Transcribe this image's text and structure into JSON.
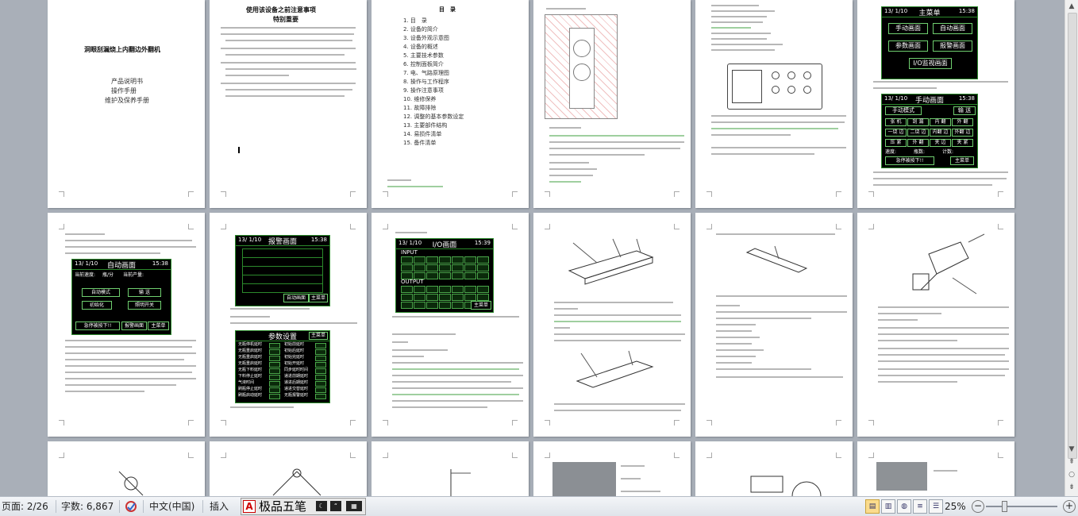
{
  "pages": {
    "p1": {
      "title": "洞眼刮漏烧上内翻边外翻机",
      "lines": [
        "产品说明书",
        "操作手册",
        "维护及保养手册"
      ]
    },
    "p2": {
      "title": "使用该设备之前注意事项",
      "subtitle": "特别重要"
    },
    "p3": {
      "title": "目　录",
      "items": [
        "1. 目　录",
        "2. 设备的简介",
        "3. 设备外观示意图",
        "4. 设备的概述",
        "5. 主要技术参数",
        "6. 控制面板简介",
        "7. 电、气路原理图",
        "8. 操作与工作程序",
        "9. 操作注意事项",
        "10. 维修保养",
        "11. 故障排除",
        "12. 调整的基本参数设定",
        "13. 主要部件结构",
        "14. 易损件清单",
        "15. 备件清单"
      ]
    },
    "p6": {
      "main_menu": {
        "date": "13/ 1/10",
        "time": "15:38",
        "title": "主菜单",
        "buttons": [
          "手动画面",
          "自动画面",
          "参数画面",
          "报警画面",
          "I/O监视画面"
        ]
      },
      "manual": {
        "date": "13/ 1/10",
        "time": "15:38",
        "title": "手动画面",
        "mode": "手动模式",
        "send": "输 送",
        "grid": [
          "张 机",
          "刮 漏",
          "内 翻",
          "外 翻",
          "一烧 边",
          "二烧 边",
          "内翻 边",
          "外翻 边",
          "压 紧",
          "外 翻",
          "夹 边",
          "夹 紧"
        ],
        "status": [
          "速度:",
          "瓶数:",
          "计数:"
        ],
        "estop": "急停被按下!!",
        "menu": "主菜单"
      }
    },
    "p7": {
      "auto": {
        "date": "13/ 1/10",
        "time": "15:38",
        "title": "自动画面",
        "speed": "当前速度:",
        "unit": "瓶/分",
        "output": "当前产量:",
        "btn_auto": "自动模式",
        "btn_send": "输 送",
        "btn_init": "初始化",
        "btn_switch": "照明开关",
        "estop": "急停被按下!!",
        "alarm": "报警画面",
        "menu": "主菜单"
      }
    },
    "p8": {
      "alarm": {
        "date": "13/ 1/10",
        "time": "15:38",
        "title": "报警画面",
        "btn_auto": "自动画面",
        "menu": "主菜单"
      },
      "params": {
        "title": "参数设置",
        "menu": "主菜单",
        "rows": [
          "无瓶停机延时",
          "初始前延时",
          "无瓶重启延时",
          "初始后延时",
          "无瓶重启延时",
          "初始完延时",
          "无瓶重启延时",
          "初始开延时",
          "无瓶下料延时",
          "同步延时时间",
          "下料停止延时",
          "递进前期延时",
          "气液时间",
          "递进后期延时",
          "刷瓶停止延时",
          "递进交替延时",
          "刷瓶启动延时",
          "无瓶报警延时"
        ]
      }
    },
    "p9": {
      "io": {
        "date": "13/ 1/10",
        "time": "15:39",
        "title": "I/O画面",
        "input": "INPUT",
        "output": "OUTPUT",
        "menu": "主菜单"
      }
    }
  },
  "statusbar": {
    "page": "页面: 2/26",
    "words": "字数: 6,867",
    "lang": "中文(中国)",
    "mode": "插入",
    "ime_name": "极品五笔",
    "zoom": "25%"
  },
  "colors": {
    "workspace": "#a9afb8",
    "hmi_bg": "#000000",
    "hmi_border": "#2c8a2c",
    "hmi_button": "#6fcf6f"
  }
}
